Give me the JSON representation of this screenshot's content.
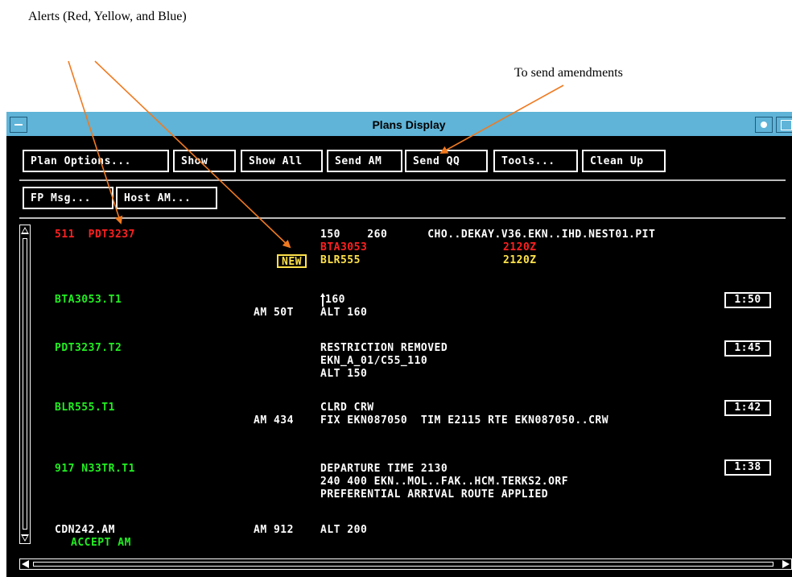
{
  "annotations": {
    "alerts_caption": "Alerts (Red, Yellow, and Blue)",
    "send_caption": "To send amendments",
    "arrow_color": "#f07a20"
  },
  "window": {
    "title": "Plans Display",
    "titlebar_color": "#5fb4d8"
  },
  "toolbar": {
    "row1": [
      "Plan Options...",
      "Show",
      "Show All",
      "Send AM",
      "Send QQ",
      "Tools...",
      "Clean Up"
    ],
    "row2": [
      "FP Msg...",
      "Host AM..."
    ]
  },
  "plans": [
    {
      "callsign": "511  PDT3237",
      "callsign_color": "red",
      "lines": [
        {
          "text": "150    260      CHO..DEKAY.V36.EKN..IHD.NEST01.PIT",
          "color": "white"
        },
        {
          "text": "BTA3053",
          "color": "red",
          "time": "2120Z"
        },
        {
          "text": "BLR555",
          "color": "yellow",
          "time": "2120Z",
          "badge": "NEW"
        }
      ]
    },
    {
      "callsign": "BTA3053.T1",
      "callsign_color": "green",
      "am": "AM 50T",
      "lines": [
        {
          "text": "160",
          "color": "white",
          "caret": true
        },
        {
          "text": "ALT 160",
          "color": "white"
        }
      ],
      "timer": "1:50"
    },
    {
      "callsign": "PDT3237.T2",
      "callsign_color": "green",
      "lines": [
        {
          "text": "RESTRICTION REMOVED",
          "color": "white"
        },
        {
          "text": "EKN_A_01/C55_110",
          "color": "white"
        },
        {
          "text": "ALT 150",
          "color": "white"
        }
      ],
      "timer": "1:45"
    },
    {
      "callsign": "BLR555.T1",
      "callsign_color": "green",
      "am": "AM 434",
      "lines": [
        {
          "text": "CLRD CRW",
          "color": "white"
        },
        {
          "text": "FIX EKN087050  TIM E2115 RTE EKN087050..CRW",
          "color": "white"
        }
      ],
      "timer": "1:42"
    },
    {
      "callsign": "917 N33TR.T1",
      "callsign_color": "green",
      "lines": [
        {
          "text": "DEPARTURE TIME 2130",
          "color": "white"
        },
        {
          "text": "240 400 EKN..MOL..FAK..HCM.TERKS2.ORF",
          "color": "white"
        },
        {
          "text": "PREFERENTIAL ARRIVAL ROUTE APPLIED",
          "color": "white"
        }
      ],
      "timer": "1:38"
    },
    {
      "callsign": "CDN242.AM",
      "callsign_color": "white",
      "sub_status": "ACCEPT AM",
      "am": "AM 912",
      "lines": [
        {
          "text": "ALT 200",
          "color": "white"
        }
      ]
    }
  ]
}
